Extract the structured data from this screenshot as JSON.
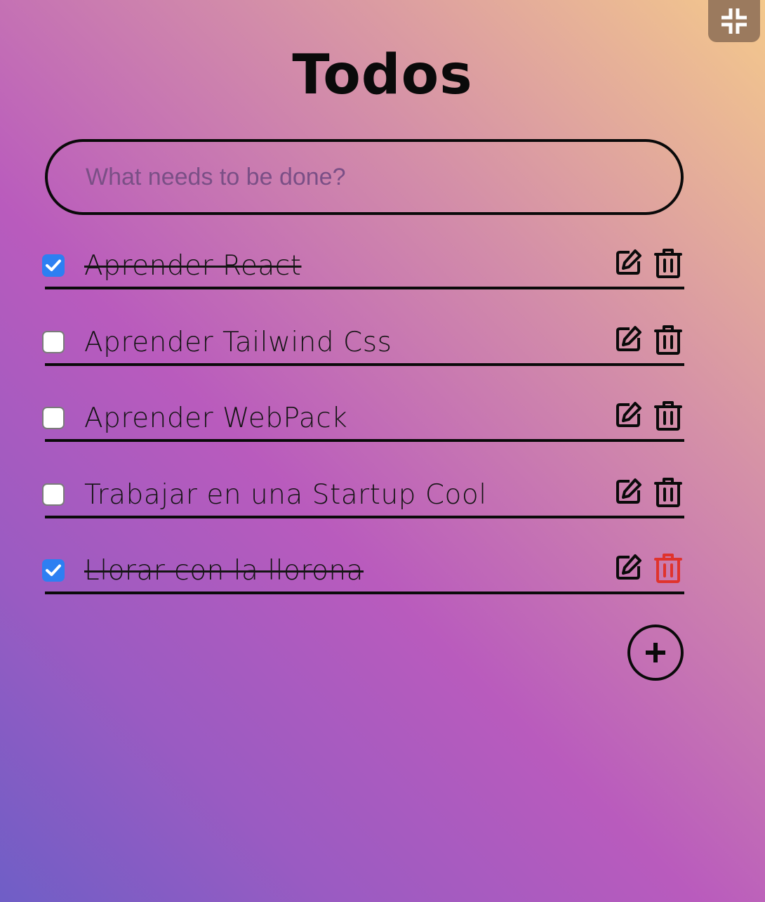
{
  "app": {
    "title": "Todos"
  },
  "search": {
    "placeholder": "What needs to be done?"
  },
  "todos": [
    {
      "label": "Aprender React",
      "completed": true
    },
    {
      "label": "Aprender Tailwind Css",
      "completed": false
    },
    {
      "label": "Aprender WebPack",
      "completed": false
    },
    {
      "label": "Trabajar en una Startup Cool",
      "completed": false
    },
    {
      "label": "Llorar con la llorona",
      "completed": true
    }
  ],
  "icons": {
    "collapse": "collapse-icon",
    "edit": "edit-icon",
    "delete": "trash-icon",
    "add": "plus-icon"
  },
  "colors": {
    "checkbox_checked": "#2d7ff2",
    "delete_highlight": "#e0332c",
    "background_top_right": "#f4c98c",
    "background_middle": "#b95bbd",
    "background_bottom_left": "#6f5ec6"
  }
}
